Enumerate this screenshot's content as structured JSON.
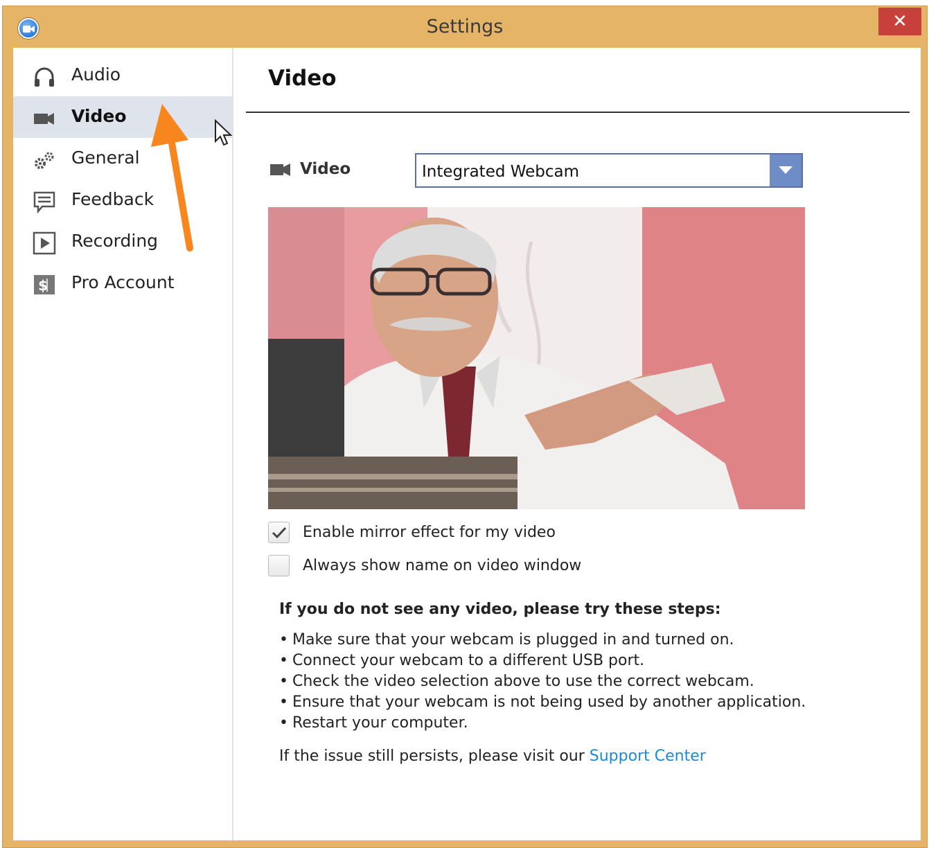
{
  "window": {
    "title": "Settings",
    "close_label": "✕",
    "frame_color": "#e6b467",
    "close_color": "#c7403c"
  },
  "sidebar": {
    "items": [
      {
        "label": "Audio",
        "icon": "headphones-icon",
        "selected": false
      },
      {
        "label": "Video",
        "icon": "video-camera-icon",
        "selected": true
      },
      {
        "label": "General",
        "icon": "gears-icon",
        "selected": false
      },
      {
        "label": "Feedback",
        "icon": "speech-bubble-icon",
        "selected": false
      },
      {
        "label": "Recording",
        "icon": "play-icon",
        "selected": false
      },
      {
        "label": "Pro Account",
        "icon": "dollar-icon",
        "selected": false
      }
    ],
    "selected_color": "#dfe4ec"
  },
  "main": {
    "title": "Video",
    "camera": {
      "label": "Video",
      "selected": "Integrated Webcam"
    },
    "options": [
      {
        "label": "Enable mirror effect for my video",
        "checked": true
      },
      {
        "label": "Always show name on video window",
        "checked": false
      }
    ],
    "help": {
      "title": "If you do not see any video, please try these steps:",
      "steps": [
        "Make sure that your webcam is plugged in and turned on.",
        "Connect your webcam to a different USB port.",
        "Check the video selection above to use the correct webcam.",
        "Ensure that your webcam is not being used by another application.",
        "Restart your computer."
      ],
      "footer_prefix": "If the issue still persists, please visit our ",
      "footer_link": "Support Center",
      "link_color": "#1a8ad4"
    }
  },
  "annotation": {
    "arrow_color": "#f7861e"
  }
}
